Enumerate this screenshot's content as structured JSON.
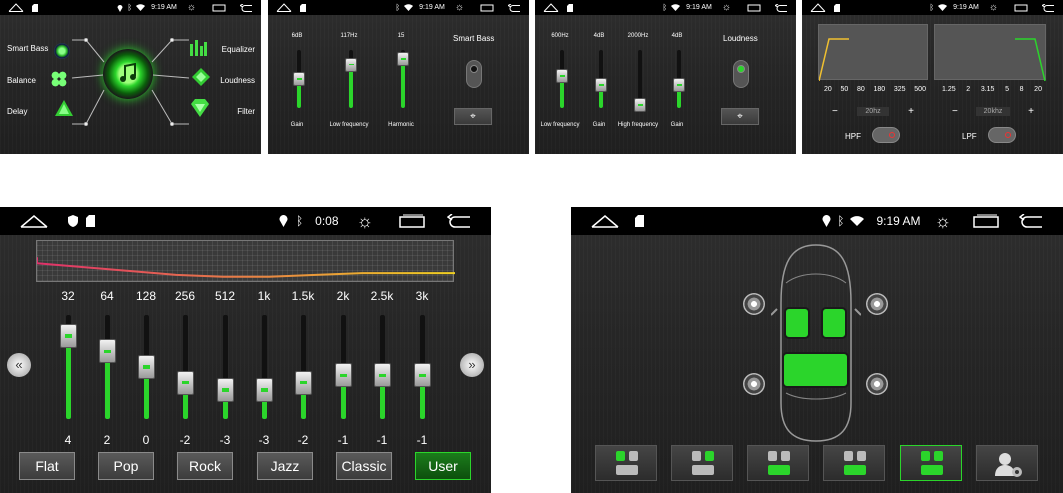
{
  "status": {
    "time_small": "9:19 AM",
    "time_eq": "0:08",
    "time_seat": "9:19 AM"
  },
  "menu": {
    "left": [
      "Smart Bass",
      "Balance",
      "Delay"
    ],
    "right": [
      "Equalizer",
      "Loudness",
      "Filter"
    ]
  },
  "smartbass": {
    "sliders": [
      {
        "top": "6dB",
        "bottom": "Gain",
        "level": 0.5
      },
      {
        "top": "117Hz",
        "bottom": "Low frequency",
        "level": 0.75
      },
      {
        "top": "15",
        "bottom": "Harmonic",
        "level": 0.85
      }
    ],
    "title": "Smart Bass"
  },
  "loudness": {
    "sliders": [
      {
        "top": "600Hz",
        "bottom": "Low frequency",
        "level": 0.55
      },
      {
        "top": "4dB",
        "bottom": "Gain",
        "level": 0.4
      },
      {
        "top": "2000Hz",
        "bottom": "High frequency",
        "level": 0.05
      },
      {
        "top": "4dB",
        "bottom": "Gain",
        "level": 0.4
      }
    ],
    "title": "Loudness"
  },
  "filter": {
    "hpf_ticks": [
      "20",
      "50",
      "80",
      "180",
      "325",
      "500"
    ],
    "lpf_ticks": [
      "1.25",
      "2",
      "3.15",
      "5",
      "8",
      "20"
    ],
    "hpf_value": "20hz",
    "lpf_value": "20khz",
    "hpf_label": "HPF",
    "lpf_label": "LPF",
    "minus": "−",
    "plus": "+"
  },
  "equalizer": {
    "bands": [
      {
        "freq": "32",
        "gain": "4",
        "level": 0.8
      },
      {
        "freq": "64",
        "gain": "2",
        "level": 0.65
      },
      {
        "freq": "128",
        "gain": "0",
        "level": 0.5
      },
      {
        "freq": "256",
        "gain": "-2",
        "level": 0.35
      },
      {
        "freq": "512",
        "gain": "-3",
        "level": 0.28
      },
      {
        "freq": "1k",
        "gain": "-3",
        "level": 0.28
      },
      {
        "freq": "1.5k",
        "gain": "-2",
        "level": 0.35
      },
      {
        "freq": "2k",
        "gain": "-1",
        "level": 0.42
      },
      {
        "freq": "2.5k",
        "gain": "-1",
        "level": 0.42
      },
      {
        "freq": "3k",
        "gain": "-1",
        "level": 0.42
      }
    ],
    "presets": [
      "Flat",
      "Pop",
      "Rock",
      "Jazz",
      "Classic",
      "User"
    ],
    "active_preset": "User",
    "colors": {
      "accent": "#2bd52b",
      "curve_start": "#e0306a",
      "curve_end": "#f0d020"
    }
  },
  "seats": {
    "buttons": 6,
    "active": 4
  }
}
